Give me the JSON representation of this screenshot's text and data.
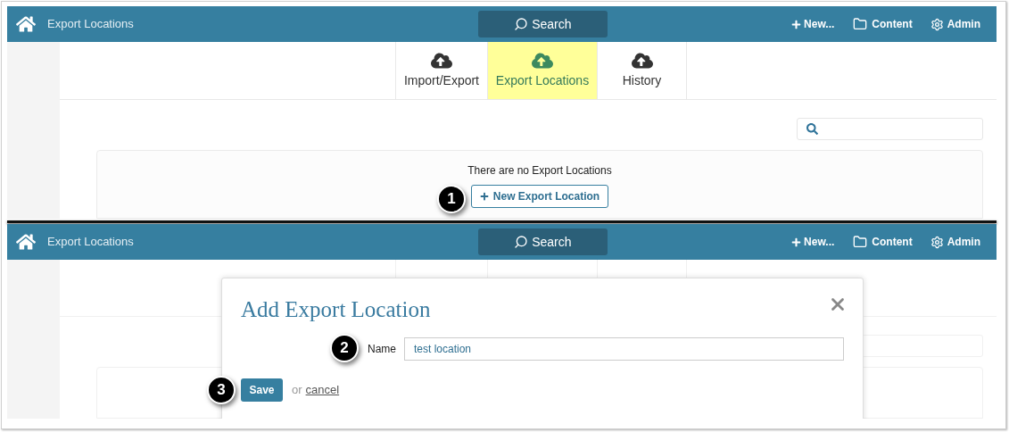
{
  "panels": [
    {
      "navbar": {
        "title": "Export Locations",
        "search": "Search",
        "new": "New...",
        "content": "Content",
        "admin": "Admin"
      },
      "tabs": [
        {
          "label": "Import/Export",
          "selected": false
        },
        {
          "label": "Export Locations",
          "selected": true
        },
        {
          "label": "History",
          "selected": false
        }
      ],
      "empty_message": "There are no Export Locations",
      "new_button": "New Export Location",
      "callout": "1"
    },
    {
      "navbar": {
        "title": "Export Locations",
        "search": "Search",
        "new": "New...",
        "content": "Content",
        "admin": "Admin"
      },
      "dialog": {
        "title": "Add Export Location",
        "name_label": "Name",
        "name_value": "test location",
        "save": "Save",
        "or": "or",
        "cancel": "cancel",
        "callouts": [
          "2",
          "3"
        ]
      }
    }
  ]
}
